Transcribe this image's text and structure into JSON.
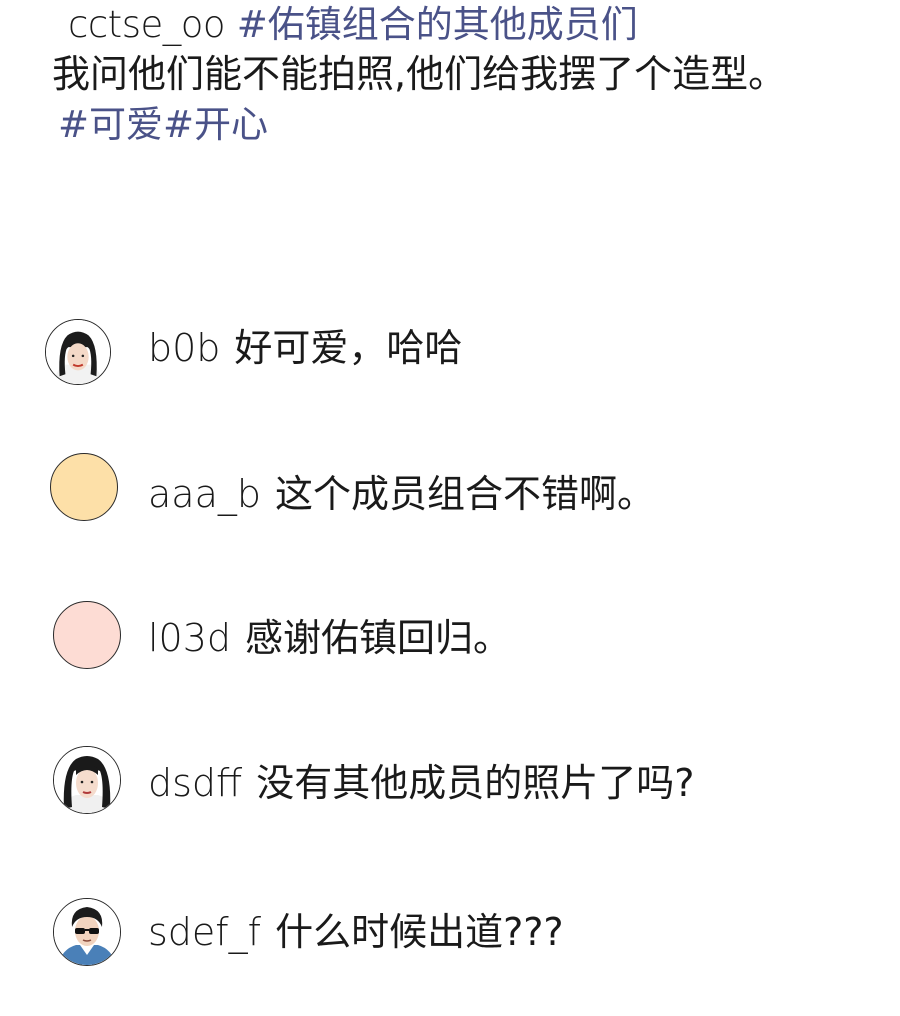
{
  "post": {
    "username": "cctse_oo",
    "title_tag": "#佑镇组合的其他成员们",
    "body": "我问他们能不能拍照,他们给我摆了个造型。",
    "tags": "#可爱#开心"
  },
  "comments": [
    {
      "user": "b0b",
      "text": "好可爱，哈哈",
      "avatar": "woman-bangs-avatar"
    },
    {
      "user": "aaa_b",
      "text": "这个成员组合不错啊。",
      "avatar": "yellow-circle-avatar"
    },
    {
      "user": "l03d",
      "text": "感谢佑镇回归。",
      "avatar": "pink-circle-avatar"
    },
    {
      "user": "dsdff",
      "text": "没有其他成员的照片了吗?",
      "avatar": "woman-longhair-avatar"
    },
    {
      "user": "sdef_f",
      "text": "什么时候出道???",
      "avatar": "man-sunglasses-avatar"
    }
  ],
  "colors": {
    "hashtag": "#4a5288",
    "text": "#1a1a1a",
    "avatar_yellow": "#fde0a8",
    "avatar_pink": "#fddcd4"
  }
}
